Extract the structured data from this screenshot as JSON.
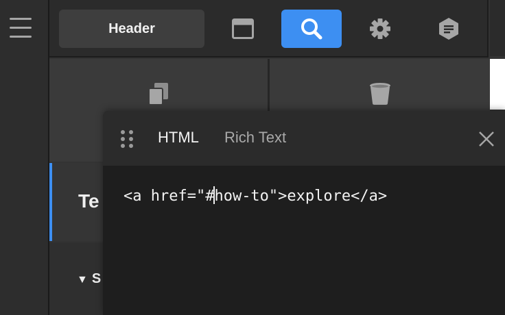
{
  "sidebar": {
    "menu_icon": "hamburger-menu-icon"
  },
  "toolbar": {
    "header_label": "Header",
    "icons": [
      "window-layout-icon",
      "search-icon",
      "gear-icon",
      "document-hexagon-icon"
    ],
    "accent_color": "#3d8ff2"
  },
  "tiles": [
    {
      "icon": "duplicate-icon"
    },
    {
      "icon": "trash-bin-icon"
    }
  ],
  "left_list": {
    "item_te": "Te",
    "item_s_arrow": "▼",
    "item_s": "S"
  },
  "code_panel": {
    "tabs": {
      "html": "HTML",
      "rich_text": "Rich Text"
    },
    "active_tab": "HTML",
    "code_before_caret": "<a href=\"#",
    "code_after_caret": "how-to\">explore</a>"
  }
}
